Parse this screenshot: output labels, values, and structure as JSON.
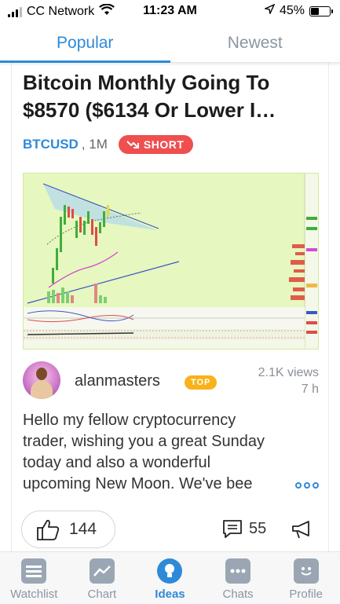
{
  "status_bar": {
    "carrier": "CC Network",
    "time": "11:23 AM",
    "battery": "45%",
    "battery_level": 0.45,
    "icons": [
      "signal-icon",
      "wifi-icon",
      "location-arrow-icon",
      "battery-icon"
    ]
  },
  "tabs": [
    {
      "label": "Popular",
      "active": true
    },
    {
      "label": "Newest",
      "active": false
    }
  ],
  "idea": {
    "title_line1": "Bitcoin Monthly Going To",
    "title_line2": "$8570 ($6134 Or Lower I…",
    "symbol": "BTCUSD",
    "timeframe": ", 1M",
    "direction": "SHORT",
    "author": "alanmasters",
    "author_badge": "TOP",
    "views": "2.1K views",
    "age": "7 h",
    "description_lines": [
      "Hello my fellow cryptocurrency",
      "trader, wishing you a great Sunday",
      "today and also a wonderful",
      "upcoming New Moon. We've bee"
    ],
    "likes": "144",
    "comments": "55"
  },
  "bottom_nav": [
    {
      "label": "Watchlist",
      "icon": "watchlist-icon",
      "active": false
    },
    {
      "label": "Chart",
      "icon": "chart-icon",
      "active": false
    },
    {
      "label": "Ideas",
      "icon": "ideas-lightbulb-icon",
      "active": true
    },
    {
      "label": "Chats",
      "icon": "chats-icon",
      "active": false
    },
    {
      "label": "Profile",
      "icon": "profile-icon",
      "active": false
    }
  ],
  "colors": {
    "accent": "#2e8ad8",
    "short": "#ef4f4f",
    "top_badge": "#f9b21a",
    "chart_bg": "#e6f7bf"
  }
}
